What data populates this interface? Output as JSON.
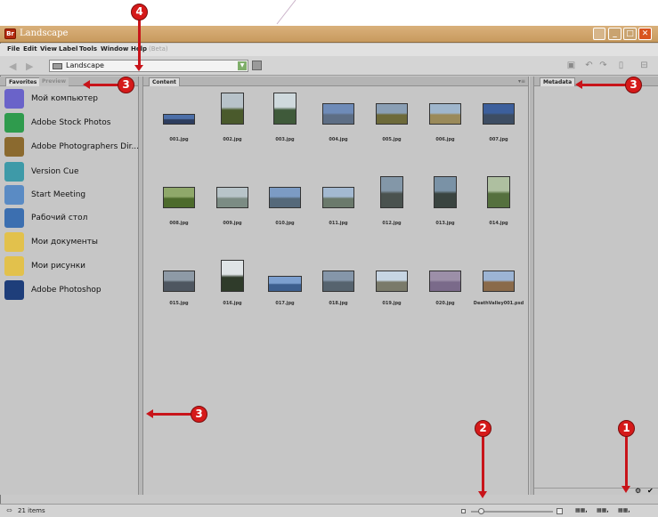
{
  "window": {
    "title": "Landscape",
    "app_icon_text": "Br",
    "controls": [
      "_",
      "□",
      "✕"
    ]
  },
  "menu": [
    "File",
    "Edit",
    "View",
    "Label",
    "Tools",
    "Window",
    "Help",
    "(Beta)"
  ],
  "toolbar": {
    "path": "Landscape",
    "back": "◀",
    "forward": "▶"
  },
  "left_panel": {
    "tabs": [
      "Favorites",
      "Preview"
    ],
    "favorites": [
      {
        "label": "Мой компьютер",
        "icon": "computer-icon",
        "color": "#6a63c9"
      },
      {
        "label": "Adobe Stock Photos",
        "icon": "stock-photos-icon",
        "color": "#2f9b4d"
      },
      {
        "label": "Adobe Photographers Dir...",
        "icon": "tripod-icon",
        "color": "#8b6a2f"
      },
      {
        "label": "Version Cue",
        "icon": "version-cue-icon",
        "color": "#3e9aa8"
      },
      {
        "label": "Start Meeting",
        "icon": "meeting-icon",
        "color": "#5a8bc4"
      },
      {
        "label": "Рабочий стол",
        "icon": "desktop-icon",
        "color": "#3c6fb0"
      },
      {
        "label": "Мои документы",
        "icon": "folder-icon",
        "color": "#e2c14c"
      },
      {
        "label": "Мои рисунки",
        "icon": "pictures-folder-icon",
        "color": "#e2c14c"
      },
      {
        "label": "Adobe Photoshop",
        "icon": "photoshop-icon",
        "color": "#1e3e7a"
      }
    ]
  },
  "content_panel": {
    "tab": "Content",
    "items": [
      {
        "name": "001.jpg",
        "shape": "wide",
        "sky": "#4c6fa8",
        "ground": "#2d3d5e"
      },
      {
        "name": "002.jpg",
        "shape": "tall",
        "sky": "#b7c2c9",
        "ground": "#4a5a2c"
      },
      {
        "name": "003.jpg",
        "shape": "tall",
        "sky": "#cfd9dd",
        "ground": "#3f5a3a"
      },
      {
        "name": "004.jpg",
        "shape": "land",
        "sky": "#6e8bb8",
        "ground": "#5d6e85"
      },
      {
        "name": "005.jpg",
        "shape": "land",
        "sky": "#8a9fb5",
        "ground": "#6d6a3a"
      },
      {
        "name": "006.jpg",
        "shape": "land",
        "sky": "#9fb6cc",
        "ground": "#9a8a5a"
      },
      {
        "name": "007.jpg",
        "shape": "land",
        "sky": "#3c5f9c",
        "ground": "#3d4d63"
      },
      {
        "name": "008.jpg",
        "shape": "land",
        "sky": "#8fa86a",
        "ground": "#4d6b2c"
      },
      {
        "name": "009.jpg",
        "shape": "land",
        "sky": "#b8c4c9",
        "ground": "#7c8c84"
      },
      {
        "name": "010.jpg",
        "shape": "land",
        "sky": "#7c9bc4",
        "ground": "#55697a"
      },
      {
        "name": "011.jpg",
        "shape": "land",
        "sky": "#a3b9d1",
        "ground": "#6b7a6c"
      },
      {
        "name": "012.jpg",
        "shape": "tall",
        "sky": "#8397a8",
        "ground": "#4a524f"
      },
      {
        "name": "013.jpg",
        "shape": "tall",
        "sky": "#7a92a6",
        "ground": "#3a4440"
      },
      {
        "name": "014.jpg",
        "shape": "tall",
        "sky": "#aebfa0",
        "ground": "#55703e"
      },
      {
        "name": "015.jpg",
        "shape": "land",
        "sky": "#8e9aa6",
        "ground": "#4e5660"
      },
      {
        "name": "016.jpg",
        "shape": "tall",
        "sky": "#dfe4e6",
        "ground": "#2f3b2a"
      },
      {
        "name": "017.jpg",
        "shape": "wide2",
        "sky": "#7c9fcf",
        "ground": "#3d5f8f"
      },
      {
        "name": "018.jpg",
        "shape": "land",
        "sky": "#8596a9",
        "ground": "#56636e"
      },
      {
        "name": "019.jpg",
        "shape": "land",
        "sky": "#c7d5e3",
        "ground": "#7a7a6a"
      },
      {
        "name": "020.jpg",
        "shape": "land",
        "sky": "#9c8fa8",
        "ground": "#7a6a8a"
      },
      {
        "name": "DeathValley001.psd",
        "shape": "land",
        "sky": "#9cb4d4",
        "ground": "#8a6a4a"
      }
    ]
  },
  "meta_panel": {
    "tab": "Metadata"
  },
  "status": {
    "text": "21 items"
  },
  "callouts": [
    {
      "num": "4"
    },
    {
      "num": "3"
    },
    {
      "num": "3"
    },
    {
      "num": "3"
    },
    {
      "num": "2"
    },
    {
      "num": "1"
    }
  ],
  "colors": {
    "callout": "#d51a1a",
    "title_bar": "#c89a5e"
  }
}
